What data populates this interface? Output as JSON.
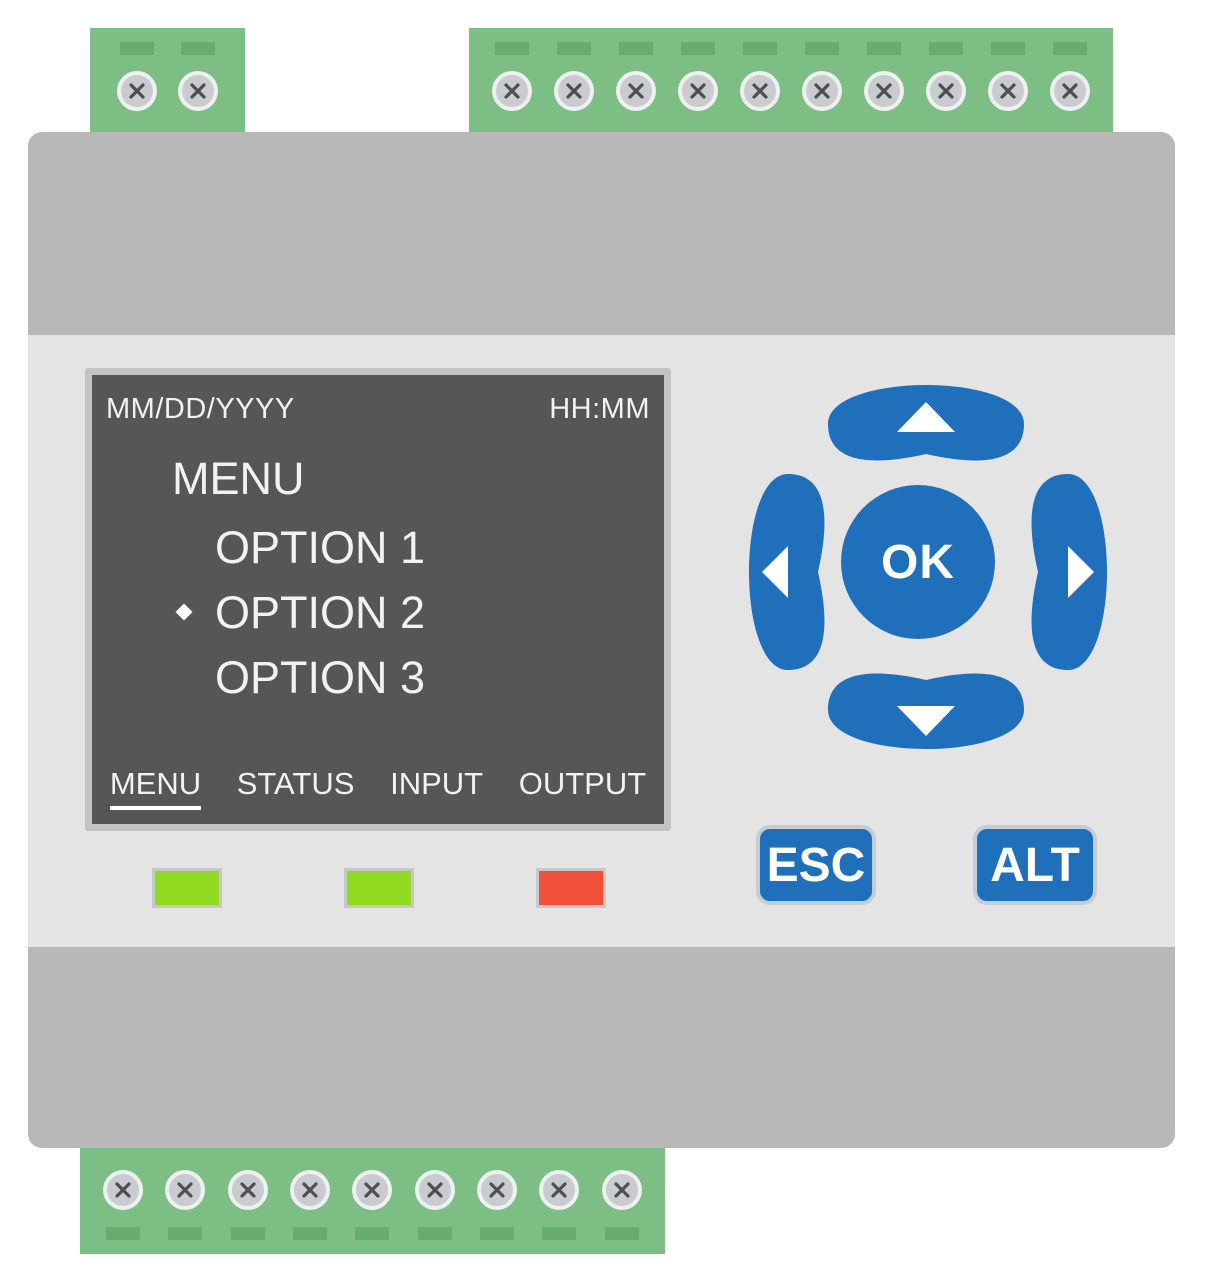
{
  "lcd": {
    "date": "MM/DD/YYYY",
    "time": "HH:MM",
    "title": "MENU",
    "options": [
      "OPTION 1",
      "OPTION 2",
      "OPTION 3"
    ],
    "selected_option": "OPTION 2",
    "tabs": [
      "MENU",
      "STATUS",
      "INPUT",
      "OUTPUT"
    ],
    "active_tab": "MENU"
  },
  "keys": {
    "ok": "OK",
    "esc": "ESC",
    "alt": "ALT"
  },
  "leds": [
    {
      "color": "#8fdc22"
    },
    {
      "color": "#8fdc22"
    },
    {
      "color": "#f0503a"
    }
  ],
  "terminals": {
    "top_left_count": 2,
    "top_right_count": 10,
    "bottom_count": 9
  },
  "colors": {
    "terminal_green": "#7dbe85",
    "housing_gray": "#b8b8b8",
    "panel_gray": "#e4e4e4",
    "lcd_background": "#565656",
    "button_blue": "#1f6fbb"
  }
}
